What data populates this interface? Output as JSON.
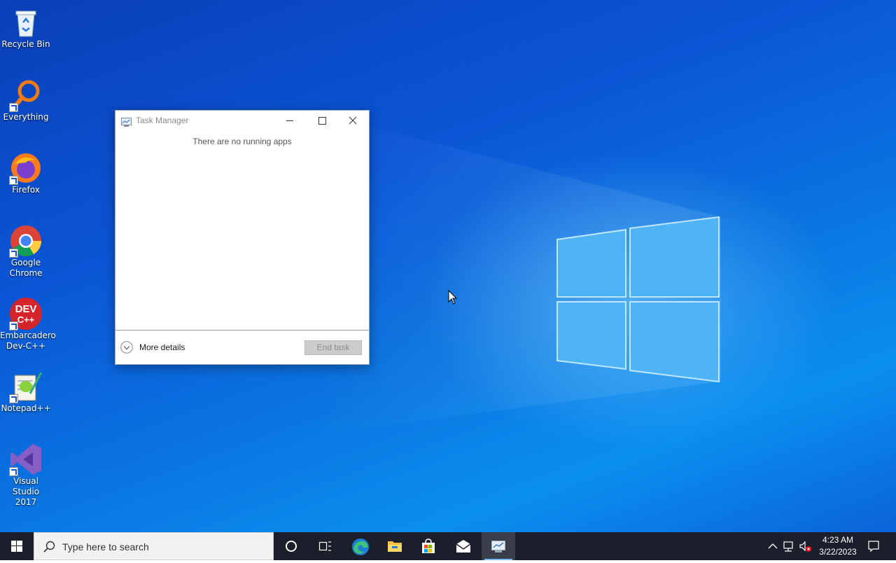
{
  "desktop": {
    "icons": [
      {
        "label": "Recycle Bin",
        "icon": "recycle-bin-icon"
      },
      {
        "label": "Everything",
        "icon": "everything-icon"
      },
      {
        "label": "Firefox",
        "icon": "firefox-icon"
      },
      {
        "label_line1": "Google",
        "label_line2": "Chrome",
        "icon": "chrome-icon"
      },
      {
        "label_line1": "Embarcadero",
        "label_line2": "Dev-C++",
        "icon": "devcpp-icon",
        "icon_text_1": "DEV",
        "icon_text_2": "C++"
      },
      {
        "label": "Notepad++",
        "icon": "notepadpp-icon"
      },
      {
        "label_line1": "Visual Studio",
        "label_line2": "2017",
        "icon": "visual-studio-icon"
      }
    ]
  },
  "task_manager": {
    "title": "Task Manager",
    "empty_message": "There are no running apps",
    "more_details_label": "More details",
    "end_task_label": "End task"
  },
  "taskbar": {
    "search_placeholder": "Type here to search",
    "pinned": [
      "cortana-icon",
      "task-view-icon",
      "edge-icon",
      "file-explorer-icon",
      "store-icon",
      "mail-icon",
      "task-manager-icon"
    ],
    "clock_time": "4:23 AM",
    "clock_date": "3/22/2023"
  },
  "colors": {
    "taskbar": "#1b1f2c",
    "desktop_blue": "#0a74e0",
    "accent": "#76b9ed"
  }
}
